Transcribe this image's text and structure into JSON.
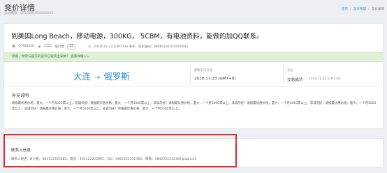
{
  "header": {
    "title": "竞价详情",
    "subtitle": "竞价编号：QT10081024000001",
    "breadcrumb": [
      "首页",
      "竞价管理",
      "竞价详情"
    ]
  },
  "detail": {
    "title": "到美国Long Beach，移动电源，300KG， 5CBM，有电池资料，能做的加QQ联系。",
    "meta": {
      "code": "QT086181",
      "views": "1521",
      "bids_label": "报价数",
      "bids": "21",
      "datetime": "2018-11-23 (GMT+8) 发布",
      "order_no": "询价编号：IN086181024000001"
    },
    "alert": "恭喜，你参与提交的竞价已被货主采纳！  查看详情>>",
    "route": {
      "from": "大连",
      "arrow": "→",
      "to": "俄罗斯"
    },
    "columns": [
      {
        "label": "最晚发货日期",
        "value": "2018-11-23 (GMT+8)"
      },
      {
        "label": "状态",
        "value": "交易成功",
        "note": "2018-11-23 (GMT+8)"
      }
    ],
    "notes_title": "补充说明",
    "notes_text": "请报最优惠价格，量大，一个月5000票以上。非诚勿扰！请报最优惠价格，量大，一个月5000票以上。非诚勿扰！请报最优惠价格，量大，一个月5000票以上。非诚勿扰！请报最优惠价格，量大，一个月5000票以上。非诚勿扰！请报最优惠价格，量大，一个月5000票以上。非诚勿扰！请报最优惠价格，量大，一个月5000票以上。非诚勿扰！请报最优惠价格，量大，一个月5000票以上。"
  },
  "contact": {
    "title": "联系人信息",
    "line": "联系人姓名: 吴小姐，482122225885；电话：482122225885；QQ：4842252232362，邮箱：4842252232362@qq.com"
  }
}
